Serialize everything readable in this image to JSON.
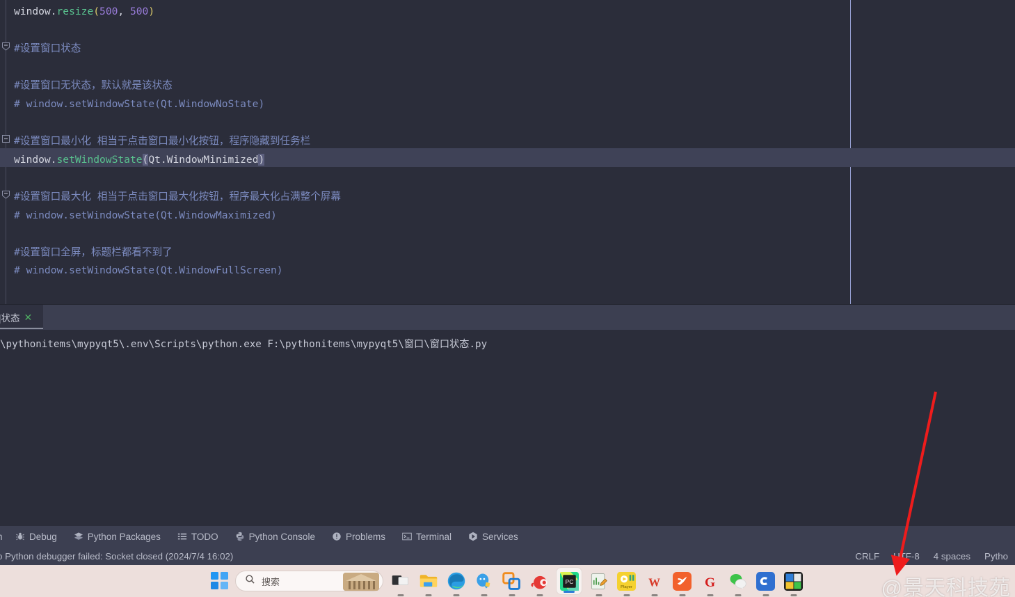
{
  "editor": {
    "lines": [
      {
        "type": "code",
        "tokens": [
          {
            "t": "window",
            "c": "kw-white"
          },
          {
            "t": ".",
            "c": "kw-white"
          },
          {
            "t": "resize",
            "c": "kw-fn"
          },
          {
            "t": "(",
            "c": "kw-paren"
          },
          {
            "t": "500",
            "c": "kw-num"
          },
          {
            "t": ", ",
            "c": "kw-white"
          },
          {
            "t": "500",
            "c": "kw-num"
          },
          {
            "t": ")",
            "c": "kw-paren"
          }
        ]
      },
      {
        "type": "blank",
        "tokens": []
      },
      {
        "type": "comment",
        "tokens": [
          {
            "t": "#设置窗口状态",
            "c": "kw-comcn"
          }
        ],
        "fold": "collapse-start"
      },
      {
        "type": "blank",
        "tokens": []
      },
      {
        "type": "comment",
        "tokens": [
          {
            "t": "#设置窗口无状态，默认就是该状态",
            "c": "kw-comcn"
          }
        ]
      },
      {
        "type": "comment",
        "tokens": [
          {
            "t": "# window.setWindowState(Qt.WindowNoState)",
            "c": "kw-com"
          }
        ]
      },
      {
        "type": "blank",
        "tokens": []
      },
      {
        "type": "comment",
        "tokens": [
          {
            "t": "#设置窗口最小化 相当于点击窗口最小化按钮，程序隐藏到任务栏",
            "c": "kw-comcn"
          }
        ],
        "fold": "expanded"
      },
      {
        "type": "code",
        "highlight": true,
        "tokens": [
          {
            "t": "window",
            "c": "kw-white"
          },
          {
            "t": ".",
            "c": "kw-white"
          },
          {
            "t": "setWindowState",
            "c": "kw-fn"
          },
          {
            "t": "(",
            "c": "brace-hl"
          },
          {
            "t": "Qt.WindowMinimized",
            "c": "kw-white"
          },
          {
            "t": ")",
            "c": "brace-hl"
          }
        ]
      },
      {
        "type": "blank",
        "tokens": []
      },
      {
        "type": "comment",
        "tokens": [
          {
            "t": "#设置窗口最大化 相当于点击窗口最大化按钮，程序最大化占满整个屏幕",
            "c": "kw-comcn"
          }
        ],
        "fold": "collapse-start"
      },
      {
        "type": "comment",
        "tokens": [
          {
            "t": "# window.setWindowState(Qt.WindowMaximized)",
            "c": "kw-com"
          }
        ]
      },
      {
        "type": "blank",
        "tokens": []
      },
      {
        "type": "comment",
        "tokens": [
          {
            "t": "#设置窗口全屏，标题栏都看不到了",
            "c": "kw-comcn"
          }
        ]
      },
      {
        "type": "comment",
        "tokens": [
          {
            "t": "# window.setWindowState(Qt.WindowFullScreen)",
            "c": "kw-com"
          }
        ]
      }
    ]
  },
  "run_window": {
    "tab_label": "|状态",
    "tab_close_glyph": "✕",
    "console_output": "\\pythonitems\\mypyqt5\\.env\\Scripts\\python.exe F:\\pythonitems\\mypyqt5\\窗口\\窗口状态.py"
  },
  "toolbar": {
    "left_stub": "n",
    "items": [
      {
        "label": "Debug",
        "icon": "bug-icon"
      },
      {
        "label": "Python Packages",
        "icon": "packages-icon"
      },
      {
        "label": "TODO",
        "icon": "list-icon"
      },
      {
        "label": "Python Console",
        "icon": "python-icon"
      },
      {
        "label": "Problems",
        "icon": "warning-icon"
      },
      {
        "label": "Terminal",
        "icon": "terminal-icon"
      },
      {
        "label": "Services",
        "icon": "services-icon"
      }
    ]
  },
  "status_bar": {
    "message": "o Python debugger failed: Socket closed (2024/7/4 16:02)",
    "line_separator": "CRLF",
    "encoding": "UTF-8",
    "indent": "4 spaces",
    "interpreter": "Pytho"
  },
  "taskbar": {
    "start_label": "start-button",
    "search_placeholder": "搜索",
    "search_icon": "search-icon",
    "icons": [
      {
        "name": "task-view-icon",
        "label": "Task View"
      },
      {
        "name": "file-explorer-icon",
        "label": "File Explorer"
      },
      {
        "name": "microsoft-edge-icon",
        "label": "Microsoft Edge"
      },
      {
        "name": "qq-icon",
        "label": "QQ"
      },
      {
        "name": "vmware-icon",
        "label": "VMware"
      },
      {
        "name": "snail-icon",
        "label": "Snail"
      },
      {
        "name": "pycharm-icon",
        "label": "PyCharm",
        "active": true
      },
      {
        "name": "notepad-icon",
        "label": "Editor"
      },
      {
        "name": "potplayer-icon",
        "label": "PotPlayer"
      },
      {
        "name": "wps-icon",
        "label": "WPS Office"
      },
      {
        "name": "orange-app-icon",
        "label": "App"
      },
      {
        "name": "gome-icon",
        "label": "G App"
      },
      {
        "name": "wechat-icon",
        "label": "WeChat"
      },
      {
        "name": "csdn-icon",
        "label": "CSDN"
      },
      {
        "name": "unknown-app-icon",
        "label": "App"
      }
    ]
  },
  "watermark": {
    "text": "@景天科技苑"
  },
  "colors": {
    "editor_bg": "#2b2d3a",
    "panel_bg": "#3c3f51",
    "caret_line": "#3f4257",
    "accent_green": "#4fae63",
    "arrow_red": "#ee1c1c",
    "taskbar_bg": "#eddfdc"
  }
}
